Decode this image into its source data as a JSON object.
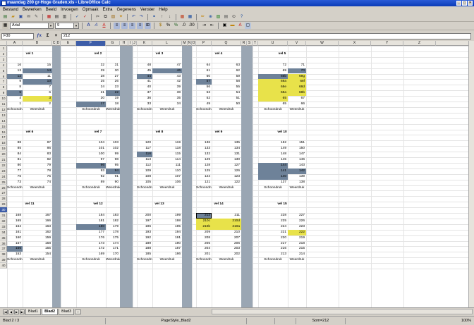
{
  "window": {
    "title": "maandag 200 gr-Hoge Graden.xls - LibreOffice Calc"
  },
  "menu": [
    "Bestand",
    "Bewerken",
    "Beeld",
    "Invoegen",
    "Opmaak",
    "Extra",
    "Gegevens",
    "Venster",
    "Help"
  ],
  "toolbar": {
    "font_name": "Arial",
    "font_size": "9"
  },
  "formula": {
    "cell_ref": "F30",
    "value": "212"
  },
  "sheet": {
    "columns": [
      "A",
      "B",
      "C",
      "D",
      "E",
      "F",
      "G",
      "H",
      "I",
      "J",
      "K",
      "L",
      "M",
      "N",
      "O",
      "P",
      "Q",
      "R",
      "S",
      "T",
      "U",
      "V",
      "W",
      "X",
      "Y",
      "Z"
    ],
    "rows": [
      "1",
      "2",
      "3",
      "4",
      "5",
      "6",
      "7",
      "8",
      "9",
      "10",
      "11",
      "12",
      "13",
      "14",
      "15",
      "16",
      "17",
      "18",
      "19",
      "20",
      "21",
      "22",
      "23",
      "24",
      "25",
      "26",
      "27",
      "28",
      "29",
      "30",
      "31",
      "32",
      "33",
      "34",
      "35",
      "36",
      "37",
      "38",
      "39",
      "40"
    ],
    "active_row": "30",
    "active_col": "F"
  },
  "labels": {
    "schoondruk": "Schoondruk",
    "weerdruk": "Weerdruk"
  },
  "blocks": [
    {
      "title": "vel 1",
      "rows": [
        [
          "16",
          "15"
        ],
        [
          "13",
          "14"
        ],
        [
          "12",
          "11"
        ],
        [
          "9",
          "10"
        ],
        [
          "8",
          "7"
        ],
        [
          "5",
          "6"
        ],
        [
          "4",
          "3"
        ],
        [
          "1",
          "2"
        ]
      ]
    },
    {
      "title": "vel 2",
      "rows": [
        [
          "32",
          "31"
        ],
        [
          "29",
          "30"
        ],
        [
          "28",
          "27"
        ],
        [
          "25",
          "26"
        ],
        [
          "24",
          "23"
        ],
        [
          "21",
          "22"
        ],
        [
          "20",
          "19"
        ],
        [
          "17",
          "18"
        ]
      ]
    },
    {
      "title": "vel 3",
      "rows": [
        [
          "48",
          "47"
        ],
        [
          "45",
          "46"
        ],
        [
          "44",
          "43"
        ],
        [
          "41",
          "42"
        ],
        [
          "40",
          "39"
        ],
        [
          "37",
          "38"
        ],
        [
          "36",
          "35"
        ],
        [
          "33",
          "34"
        ]
      ]
    },
    {
      "title": "vel 4",
      "rows": [
        [
          "64",
          "63"
        ],
        [
          "61",
          "62"
        ],
        [
          "60",
          "59"
        ],
        [
          "57",
          "58"
        ],
        [
          "56",
          "55"
        ],
        [
          "53",
          "54"
        ],
        [
          "52",
          "51"
        ],
        [
          "49",
          "50"
        ]
      ]
    },
    {
      "title": "vel 5",
      "rows": [
        [
          "72",
          "71"
        ],
        [
          "69",
          "70"
        ],
        [
          "66b",
          "69g"
        ],
        [
          "69a",
          "68f"
        ],
        [
          "68e",
          "68d"
        ],
        [
          "68a",
          "68b"
        ],
        [
          "65",
          "67"
        ],
        [
          "65",
          "66"
        ]
      ]
    },
    {
      "title": "vel 6",
      "rows": [
        [
          "88",
          "87"
        ],
        [
          "85",
          "86"
        ],
        [
          "84",
          "83"
        ],
        [
          "81",
          "82"
        ],
        [
          "80",
          "79"
        ],
        [
          "77",
          "78"
        ],
        [
          "76",
          "75"
        ],
        [
          "73",
          "74"
        ]
      ]
    },
    {
      "title": "vel 7",
      "rows": [
        [
          "104",
          "103"
        ],
        [
          "101",
          "102"
        ],
        [
          "100",
          "99"
        ],
        [
          "97",
          "98"
        ],
        [
          "96",
          "95"
        ],
        [
          "93",
          "94"
        ],
        [
          "92",
          "91"
        ],
        [
          "89",
          "90"
        ]
      ]
    },
    {
      "title": "vel 8",
      "rows": [
        [
          "120",
          "119"
        ],
        [
          "117",
          "118"
        ],
        [
          "116",
          "115"
        ],
        [
          "113",
          "114"
        ],
        [
          "112",
          "111"
        ],
        [
          "109",
          "110"
        ],
        [
          "108",
          "107"
        ],
        [
          "105",
          "106"
        ]
      ]
    },
    {
      "title": "vel 9",
      "rows": [
        [
          "136",
          "135"
        ],
        [
          "133",
          "134"
        ],
        [
          "132",
          "131"
        ],
        [
          "129",
          "130"
        ],
        [
          "128",
          "127"
        ],
        [
          "125",
          "126"
        ],
        [
          "124",
          "123"
        ],
        [
          "121",
          "122"
        ]
      ]
    },
    {
      "title": "vel 10",
      "rows": [
        [
          "152",
          "151"
        ],
        [
          "149",
          "150"
        ],
        [
          "148",
          "147"
        ],
        [
          "145",
          "146"
        ],
        [
          "144",
          "143"
        ],
        [
          "141",
          "142"
        ],
        [
          "140",
          "139"
        ],
        [
          "137",
          "138"
        ]
      ]
    },
    {
      "title": "vel 11",
      "rows": [
        [
          "168",
          "167"
        ],
        [
          "165",
          "166"
        ],
        [
          "164",
          "163"
        ],
        [
          "161",
          "162"
        ],
        [
          "160",
          "159"
        ],
        [
          "157",
          "158"
        ],
        [
          "156",
          "155"
        ],
        [
          "153",
          "154"
        ]
      ]
    },
    {
      "title": "vel 12",
      "rows": [
        [
          "184",
          "183"
        ],
        [
          "181",
          "182"
        ],
        [
          "180",
          "179"
        ],
        [
          "177",
          "178"
        ],
        [
          "176",
          "175"
        ],
        [
          "173",
          "174"
        ],
        [
          "172",
          "171"
        ],
        [
          "169",
          "170"
        ]
      ]
    },
    {
      "title": "vel 13",
      "rows": [
        [
          "200",
          "199"
        ],
        [
          "197",
          "198"
        ],
        [
          "196",
          "195"
        ],
        [
          "193",
          "194"
        ],
        [
          "192",
          "191"
        ],
        [
          "189",
          "190"
        ],
        [
          "188",
          "187"
        ],
        [
          "185",
          "186"
        ]
      ]
    },
    {
      "title": "vel 14",
      "rows": [
        [
          "212",
          "211"
        ],
        [
          "210c",
          "210d"
        ],
        [
          "210b",
          "210a"
        ],
        [
          "209",
          "210"
        ],
        [
          "208",
          "207"
        ],
        [
          "205",
          "206"
        ],
        [
          "204",
          "203"
        ],
        [
          "201",
          "202"
        ]
      ]
    },
    {
      "title": "vel 15",
      "rows": [
        [
          "228",
          "227"
        ],
        [
          "225",
          "226"
        ],
        [
          "224",
          "223"
        ],
        [
          "221",
          "222"
        ],
        [
          "220",
          "219"
        ],
        [
          "217",
          "218"
        ],
        [
          "216",
          "215"
        ],
        [
          "213",
          "214"
        ]
      ]
    }
  ],
  "tabs": [
    "Blad1",
    "Blad2",
    "Blad3"
  ],
  "active_tab": "Blad2",
  "status": {
    "sheet": "Blad 2 / 3",
    "style": "PageStyle_Blad2",
    "sum": "Som=212",
    "zoom": "100%"
  }
}
